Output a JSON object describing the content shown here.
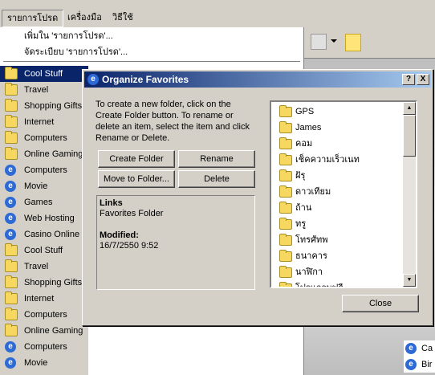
{
  "menubar": {
    "items": [
      "รายการโปรด",
      "เครื่องมือ",
      "วิธีใช้"
    ]
  },
  "fav_menu": {
    "add_label": "เพิ่มใน 'รายการโปรด'...",
    "organize_label": "จัดระเบียบ 'รายการโปรด'...",
    "items": [
      {
        "label": "Cool Stuff",
        "icon": "folder-icon"
      },
      {
        "label": "Travel",
        "icon": "folder-icon"
      },
      {
        "label": "Shopping Gifts",
        "icon": "folder-icon"
      },
      {
        "label": "Internet",
        "icon": "folder-icon"
      },
      {
        "label": "Computers",
        "icon": "folder-icon"
      },
      {
        "label": "Online Gaming",
        "icon": "folder-icon"
      },
      {
        "label": "Computers",
        "icon": "ie-icon"
      },
      {
        "label": "Movie",
        "icon": "ie-icon"
      },
      {
        "label": "Games",
        "icon": "ie-icon"
      },
      {
        "label": "Web Hosting",
        "icon": "ie-icon"
      },
      {
        "label": "Casino Online",
        "icon": "ie-icon"
      },
      {
        "label": "Cool Stuff",
        "icon": "folder-icon"
      },
      {
        "label": "Travel",
        "icon": "folder-icon"
      },
      {
        "label": "Shopping Gifts",
        "icon": "folder-icon"
      },
      {
        "label": "Internet",
        "icon": "folder-icon"
      },
      {
        "label": "Computers",
        "icon": "folder-icon"
      },
      {
        "label": "Online Gaming",
        "icon": "folder-icon"
      },
      {
        "label": "Computers",
        "icon": "ie-icon"
      },
      {
        "label": "Movie",
        "icon": "ie-icon"
      }
    ]
  },
  "right_list": [
    "Ca",
    "Bir"
  ],
  "dialog": {
    "title": "Organize Favorites",
    "help_btn": "?",
    "close_btn": "X",
    "instructions": "To create a new folder, click on the Create Folder button. To rename or delete an item, select the item and click Rename or Delete.",
    "create_folder": "Create Folder",
    "rename": "Rename",
    "move_to_folder": "Move to Folder...",
    "delete": "Delete",
    "info_name": "Links",
    "info_type": "Favorites Folder",
    "info_modified_label": "Modified:",
    "info_modified_value": "16/7/2550 9:52",
    "close": "Close",
    "folders": [
      "GPS",
      "James",
      "คอม",
      "เช็คความเร็วเนท",
      "ฝัรุ",
      "ดาวเทียม",
      "ถ้าน",
      "ทรู",
      "โทรศัทพ",
      "ธนาคาร",
      "นาฬิกา",
      "โปรแกรมฟรี"
    ]
  },
  "colors": {
    "selection": "#0a246a",
    "titlebar_start": "#0a246a",
    "titlebar_end": "#a6caf0",
    "folder": "#f6d860"
  }
}
